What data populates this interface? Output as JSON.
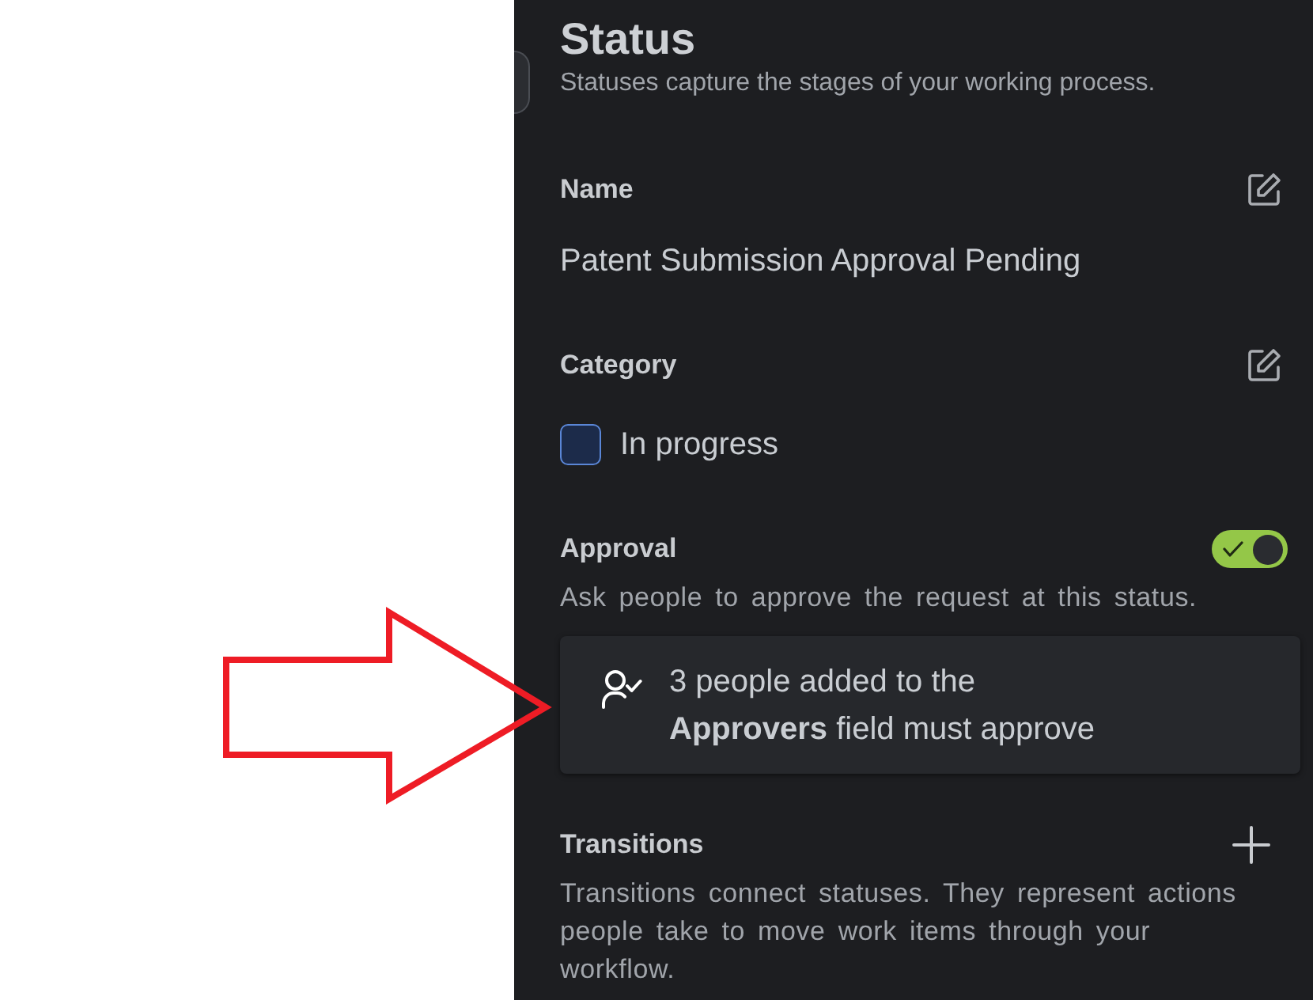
{
  "panel": {
    "title": "Status",
    "subtitle": "Statuses capture the stages of your working process."
  },
  "sections": [
    {
      "kind": "name",
      "label": "Name",
      "value": "Patent Submission Approval Pending"
    },
    {
      "kind": "category",
      "label": "Category",
      "value": "In progress",
      "color": "#1c2b4a"
    },
    {
      "kind": "approval",
      "label": "Approval",
      "on": true,
      "description": "Ask people to approve the request at this status.",
      "note_lines": [
        "3 people added to the",
        "**Approvers** field must approve"
      ]
    },
    {
      "kind": "transitions",
      "label": "Transitions",
      "description": "Transitions connect statuses. They represent actions people take to move work items through your workflow."
    }
  ]
}
